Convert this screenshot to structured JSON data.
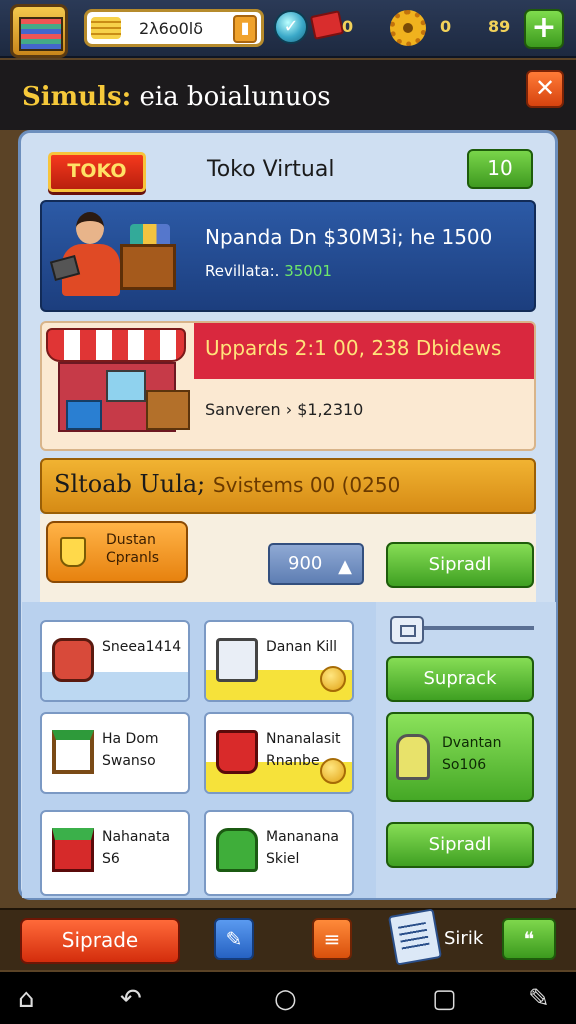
{
  "topbar": {
    "coins": "2λ6o0lδ",
    "tickets": "0",
    "gears": "0",
    "gems_count": "89",
    "plus_label": "+"
  },
  "header": {
    "title_part1": "Simuls:",
    "title_part2": " eia boialunuos",
    "close_label": "✕"
  },
  "shop": {
    "badge": "TOKO",
    "title": "Toko Virtual",
    "level": "10"
  },
  "info": {
    "line1": "Npanda Dn $30M3i;  he 1500",
    "line2_label": "Revillata:.",
    "line2_value": " 35001"
  },
  "upgrade": {
    "line1": "Uppards 2:1 00, 238 Dbidews",
    "line2": "Sanveren › $1,2310"
  },
  "systems": {
    "title": "Sltoab Uula; ",
    "subtitle": "Svistems 00 (0250",
    "orange_btn": "Dustan Cpranls",
    "number": "900",
    "number_icon": "▲",
    "upgrade_btn": "Sipradl"
  },
  "grid": {
    "tiles": [
      {
        "label": "Sneea1414"
      },
      {
        "label": "Danan Kill"
      },
      {
        "label": "Ha Dom Swanso"
      },
      {
        "label": "Nnanalasit Rnanbe"
      },
      {
        "label": "Nahanata S6"
      },
      {
        "label": "Mananana Skiel"
      }
    ],
    "right_btn1": "Suprack",
    "green_tile": "Dvantan So106",
    "right_btn2": "Sipradl"
  },
  "bottom": {
    "main_btn": "Siprade",
    "label": "Sirik"
  },
  "colors": {
    "accent_green": "#3fa022",
    "accent_red": "#d9283e",
    "accent_orange": "#f1b332",
    "panel_bg": "#cfdff2"
  }
}
